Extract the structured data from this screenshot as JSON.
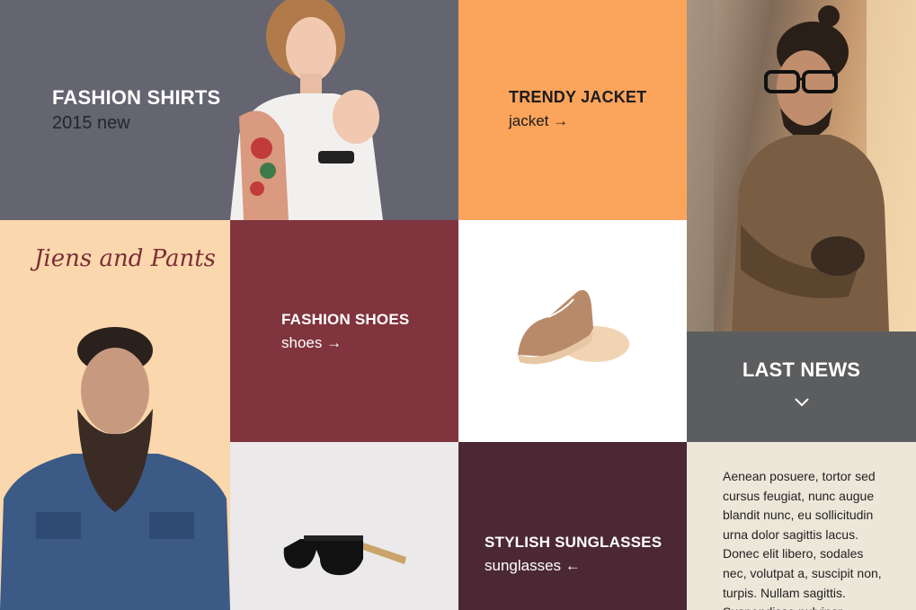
{
  "tiles": {
    "fashion_shirts": {
      "title": "FASHION SHIRTS",
      "subtitle": "2015 new",
      "color": "#646571"
    },
    "trendy_jacket": {
      "title": "TRENDY JACKET",
      "subtitle": "jacket →",
      "color": "#fba45c"
    },
    "jiens_and_pants": {
      "script_title": "Jiens and Pants",
      "color": "#fbd7ad"
    },
    "fashion_shoes": {
      "title": "FASHION SHOES",
      "subtitle": "shoes →",
      "color": "#80343d"
    },
    "last_news": {
      "title": "LAST NEWS",
      "icon": "chevron-down-icon",
      "color": "#5c5d5e"
    },
    "stylish_sunglasses": {
      "title": "STYLISH SUNGLASSES",
      "subtitle": "sunglasses ←",
      "color": "#4c2835"
    },
    "news_text": {
      "body": "Aenean posuere, tortor sed cursus feugiat, nunc augue blandit nunc, eu sollicitudin urna dolor sagittis lacus. Donec elit libero, sodales nec, volutpat a, suscipit non, turpis. Nullam sagittis. Suspendisse pulvinar",
      "color": "#ece7d9"
    }
  },
  "images": {
    "woman_model": "woman-with-tattoo-photo",
    "man_glasses": "man-in-tweed-jacket-photo",
    "bearded_man": "bearded-man-denim-shirt-photo",
    "boat_shoe": "boat-shoe-photo",
    "sunglasses": "sunglasses-photo"
  }
}
